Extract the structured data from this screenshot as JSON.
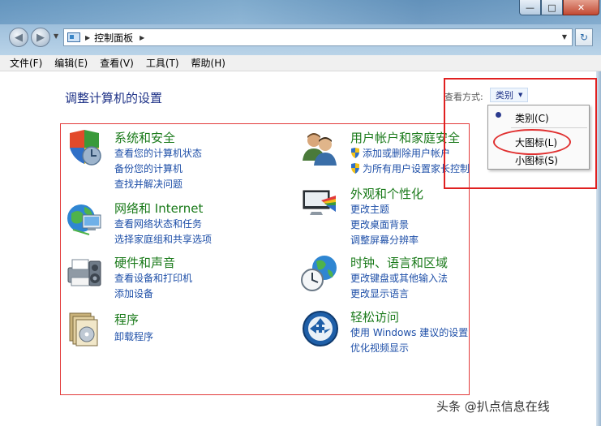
{
  "window": {
    "controls": {
      "minimize": "—",
      "maximize": "□",
      "close": "✕"
    }
  },
  "nav": {
    "back_icon": "back-arrow-icon",
    "forward_icon": "forward-arrow-icon",
    "address": "控制面板",
    "refresh_icon": "refresh-icon"
  },
  "menubar": {
    "items": [
      "文件(F)",
      "编辑(E)",
      "查看(V)",
      "工具(T)",
      "帮助(H)"
    ]
  },
  "page": {
    "title": "调整计算机的设置",
    "view_label": "查看方式:",
    "view_selected": "类别"
  },
  "view_menu": {
    "options": [
      "类别(C)",
      "大图标(L)",
      "小图标(S)"
    ],
    "checked": "类别(C)",
    "highlighted_annotation": "大图标(L)"
  },
  "categories": [
    {
      "title": "系统和安全",
      "icon": "system-security-icon",
      "links": [
        "查看您的计算机状态",
        "备份您的计算机",
        "查找并解决问题"
      ]
    },
    {
      "title": "网络和 Internet",
      "icon": "network-globe-icon",
      "links": [
        "查看网络状态和任务",
        "选择家庭组和共享选项"
      ]
    },
    {
      "title": "硬件和声音",
      "icon": "printer-hardware-icon",
      "links": [
        "查看设备和打印机",
        "添加设备"
      ]
    },
    {
      "title": "程序",
      "icon": "programs-icon",
      "links": [
        "卸载程序"
      ]
    },
    {
      "title": "用户帐户和家庭安全",
      "icon": "user-accounts-icon",
      "links": [
        "添加或删除用户帐户",
        "为所有用户设置家长控制"
      ]
    },
    {
      "title": "外观和个性化",
      "icon": "appearance-icon",
      "links": [
        "更改主题",
        "更改桌面背景",
        "调整屏幕分辨率"
      ]
    },
    {
      "title": "时钟、语言和区域",
      "icon": "clock-language-icon",
      "links": [
        "更改键盘或其他输入法",
        "更改显示语言"
      ]
    },
    {
      "title": "轻松访问",
      "icon": "ease-of-access-icon",
      "links": [
        "使用 Windows 建议的设置",
        "优化视频显示"
      ]
    }
  ],
  "watermark": "头条 @扒点信息在线",
  "colors": {
    "category_title": "#1a7a1a",
    "link": "#1e4fa8",
    "annotation_red": "#e02020",
    "page_title": "#1e3287"
  }
}
